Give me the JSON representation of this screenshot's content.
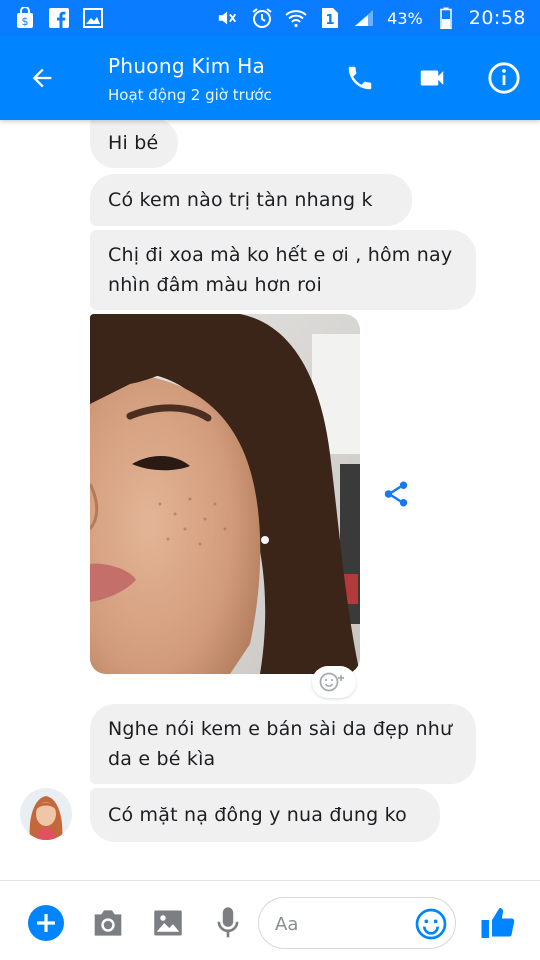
{
  "status_bar": {
    "battery_percent": "43%",
    "time": "20:58"
  },
  "header": {
    "contact_name": "Phuong Kim Ha",
    "contact_status": "Hoạt động 2 giờ trước"
  },
  "messages": [
    {
      "text": "Hi bé"
    },
    {
      "text": "Có kem nào trị tàn nhang k"
    },
    {
      "text": "Chị đi xoa mà ko hết e ơi , hôm nay nhìn đâm màu hơn roi"
    },
    {
      "text": "Nghe nói kem e bán sài da đẹp như da e bé kìa"
    },
    {
      "text": "Có mặt nạ đông y nua đung ko"
    }
  ],
  "composer": {
    "placeholder": "Aa"
  },
  "colors": {
    "brand_blue": "#0084ff",
    "bubble_gray": "#f1f0f0"
  }
}
